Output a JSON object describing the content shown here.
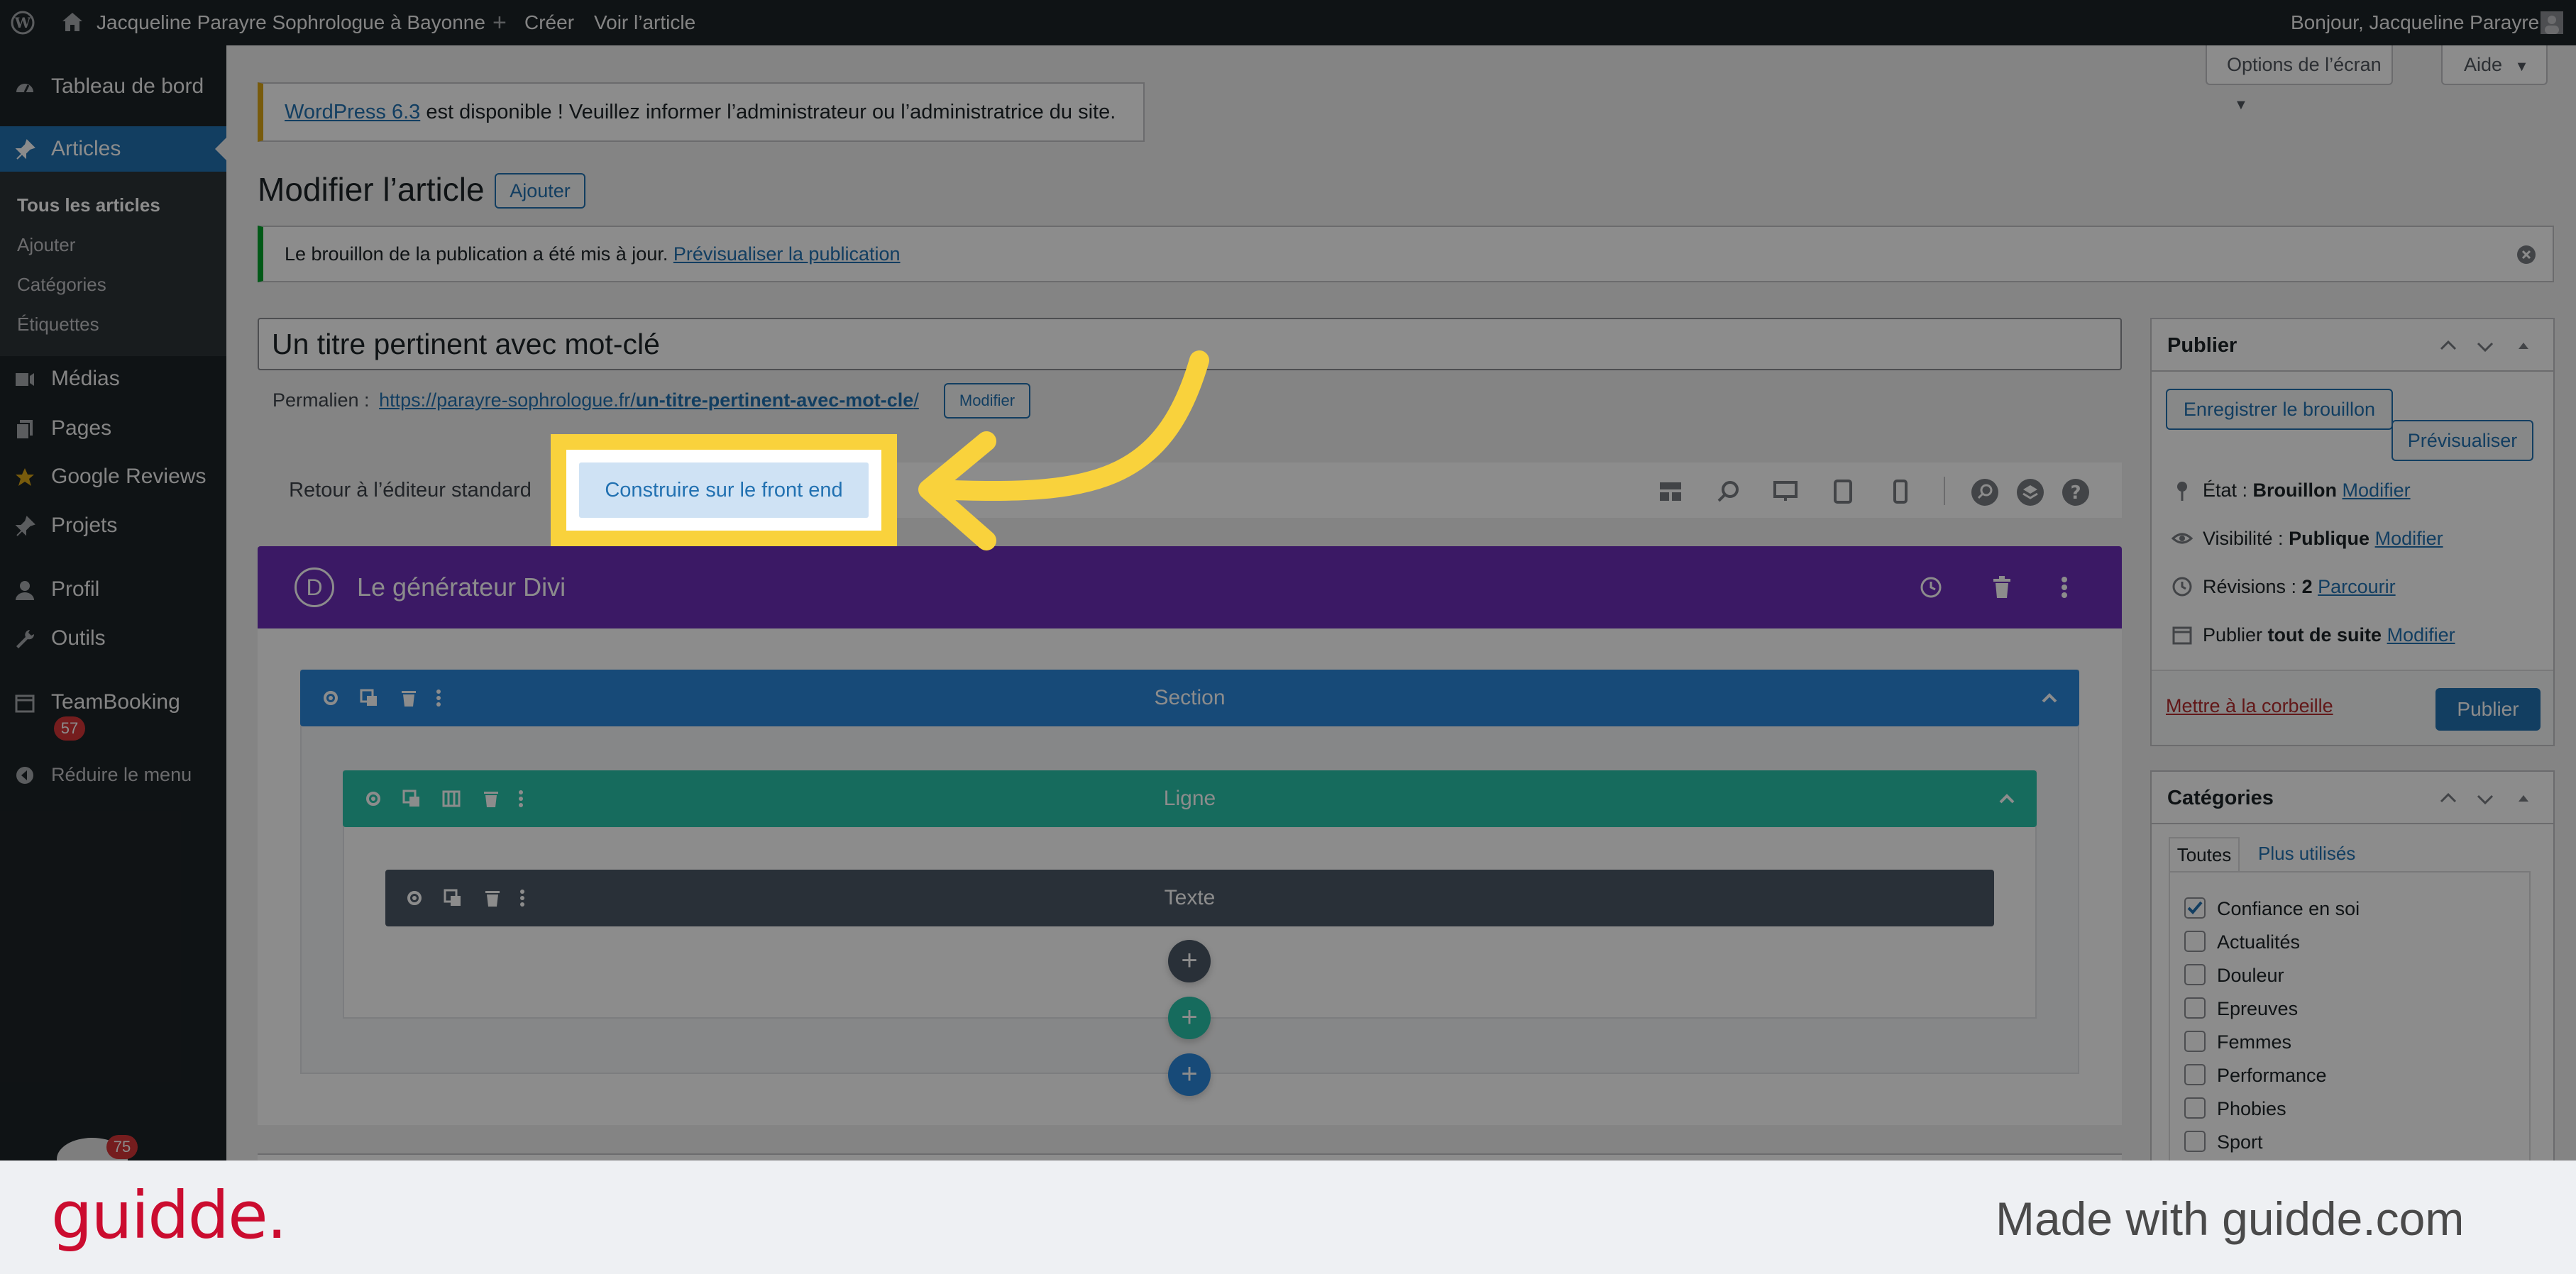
{
  "admin_bar": {
    "site_name": "Jacqueline Parayre Sophrologue à Bayonne",
    "create": "Créer",
    "view_article": "Voir l’article",
    "greeting": "Bonjour, Jacqueline Parayre"
  },
  "sidebar": {
    "dashboard": "Tableau de bord",
    "articles": "Articles",
    "sub": [
      "Tous les articles",
      "Ajouter",
      "Catégories",
      "Étiquettes"
    ],
    "medias": "Médias",
    "pages": "Pages",
    "google_reviews": "Google Reviews",
    "projets": "Projets",
    "profil": "Profil",
    "outils": "Outils",
    "teambooking": "TeamBooking",
    "teambooking_badge": "57",
    "collapse": "Réduire le menu",
    "avatar_badge": "75"
  },
  "screen_options": "Options de l’écran",
  "help": "Aide",
  "update_notice": {
    "link": "WordPress 6.3",
    "text": " est disponible ! Veuillez informer l’administrateur ou l’administratrice du site."
  },
  "page_title": "Modifier l’article",
  "add_button": "Ajouter",
  "draft_notice": {
    "text": "Le brouillon de la publication a été mis à jour. ",
    "link": "Prévisualiser la publication"
  },
  "post_title": "Un titre pertinent avec mot-clé",
  "permalink": {
    "label": "Permalien :",
    "base": "https://parayre-sophrologue.fr/",
    "slug": "un-titre-pertinent-avec-mot-cle",
    "slash": "/",
    "modify": "Modifier"
  },
  "divi_toolbar": {
    "back": "Retour à l’éditeur standard",
    "frontend": "Construire sur le front end"
  },
  "divi": {
    "logo": "D",
    "title": "Le générateur Divi",
    "section": "Section",
    "row": "Ligne",
    "module": "Texte",
    "plus": "+"
  },
  "publish": {
    "title": "Publier",
    "save_draft": "Enregistrer le brouillon",
    "preview": "Prévisualiser",
    "status_label": "État : ",
    "status_value": "Brouillon",
    "visibility_label": "Visibilité : ",
    "visibility_value": "Publique",
    "revisions_label": "Révisions : ",
    "revisions_value": "2",
    "browse": "Parcourir",
    "publish_label": "Publier ",
    "publish_value": "tout de suite",
    "modify": "Modifier",
    "trash": "Mettre à la corbeille",
    "publish_button": "Publier"
  },
  "categories": {
    "title": "Catégories",
    "tab_all": "Toutes",
    "tab_used": "Plus utilisés",
    "items": [
      {
        "label": "Confiance en soi",
        "checked": true
      },
      {
        "label": "Actualités",
        "checked": false
      },
      {
        "label": "Douleur",
        "checked": false
      },
      {
        "label": "Epreuves",
        "checked": false
      },
      {
        "label": "Femmes",
        "checked": false
      },
      {
        "label": "Performance",
        "checked": false
      },
      {
        "label": "Phobies",
        "checked": false
      },
      {
        "label": "Sport",
        "checked": false
      }
    ]
  },
  "footer": {
    "logo": "guidde.",
    "made_with": "Made with guidde.com"
  },
  "colors": {
    "highlight": "#f9d23c",
    "divi_purple": "#6c2eb9",
    "section_blue": "#2b87da",
    "row_green": "#29c4a9",
    "module_dark": "#4c5866",
    "wp_blue": "#2271b1",
    "guidde_red": "#cb0c2f"
  }
}
